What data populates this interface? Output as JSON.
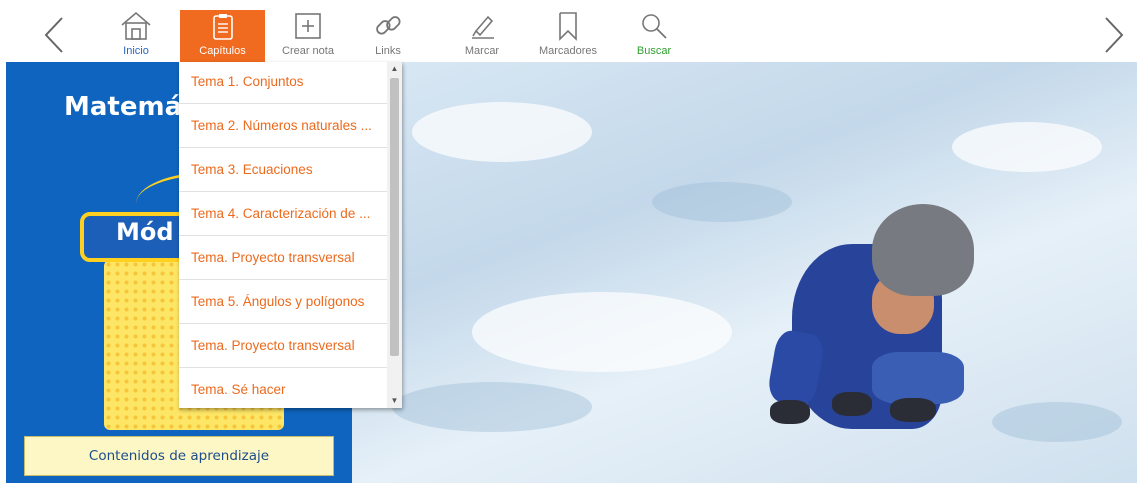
{
  "toolbar": {
    "prev_icon": "chevron-left-icon",
    "next_icon": "chevron-right-icon",
    "items": [
      {
        "label": "Inicio",
        "icon": "home-icon"
      },
      {
        "label": "Capítulos",
        "icon": "list-document-icon",
        "active": true
      },
      {
        "label": "Crear nota",
        "icon": "add-note-icon"
      },
      {
        "label": "Links",
        "icon": "link-icon"
      },
      {
        "label": "Marcar",
        "icon": "highlighter-icon"
      },
      {
        "label": "Marcadores",
        "icon": "bookmark-icon"
      },
      {
        "label": "Buscar",
        "icon": "search-icon"
      }
    ],
    "accent_color": "#f06a1f"
  },
  "chapters_menu": {
    "items": [
      "Tema 1. Conjuntos",
      "Tema 2. Números naturales ...",
      "Tema 3. Ecuaciones",
      "Tema 4. Caracterización de ...",
      "Tema. Proyecto transversal",
      "Tema 5. Ángulos y polígonos",
      "Tema. Proyecto transversal",
      "Tema. Sé hacer"
    ],
    "text_color": "#ec6a1d"
  },
  "cover": {
    "title_partial": "Matemá",
    "module_partial": "Mód",
    "contents_button": "Contenidos de aprendizaje",
    "panel_color": "#0e64be"
  }
}
